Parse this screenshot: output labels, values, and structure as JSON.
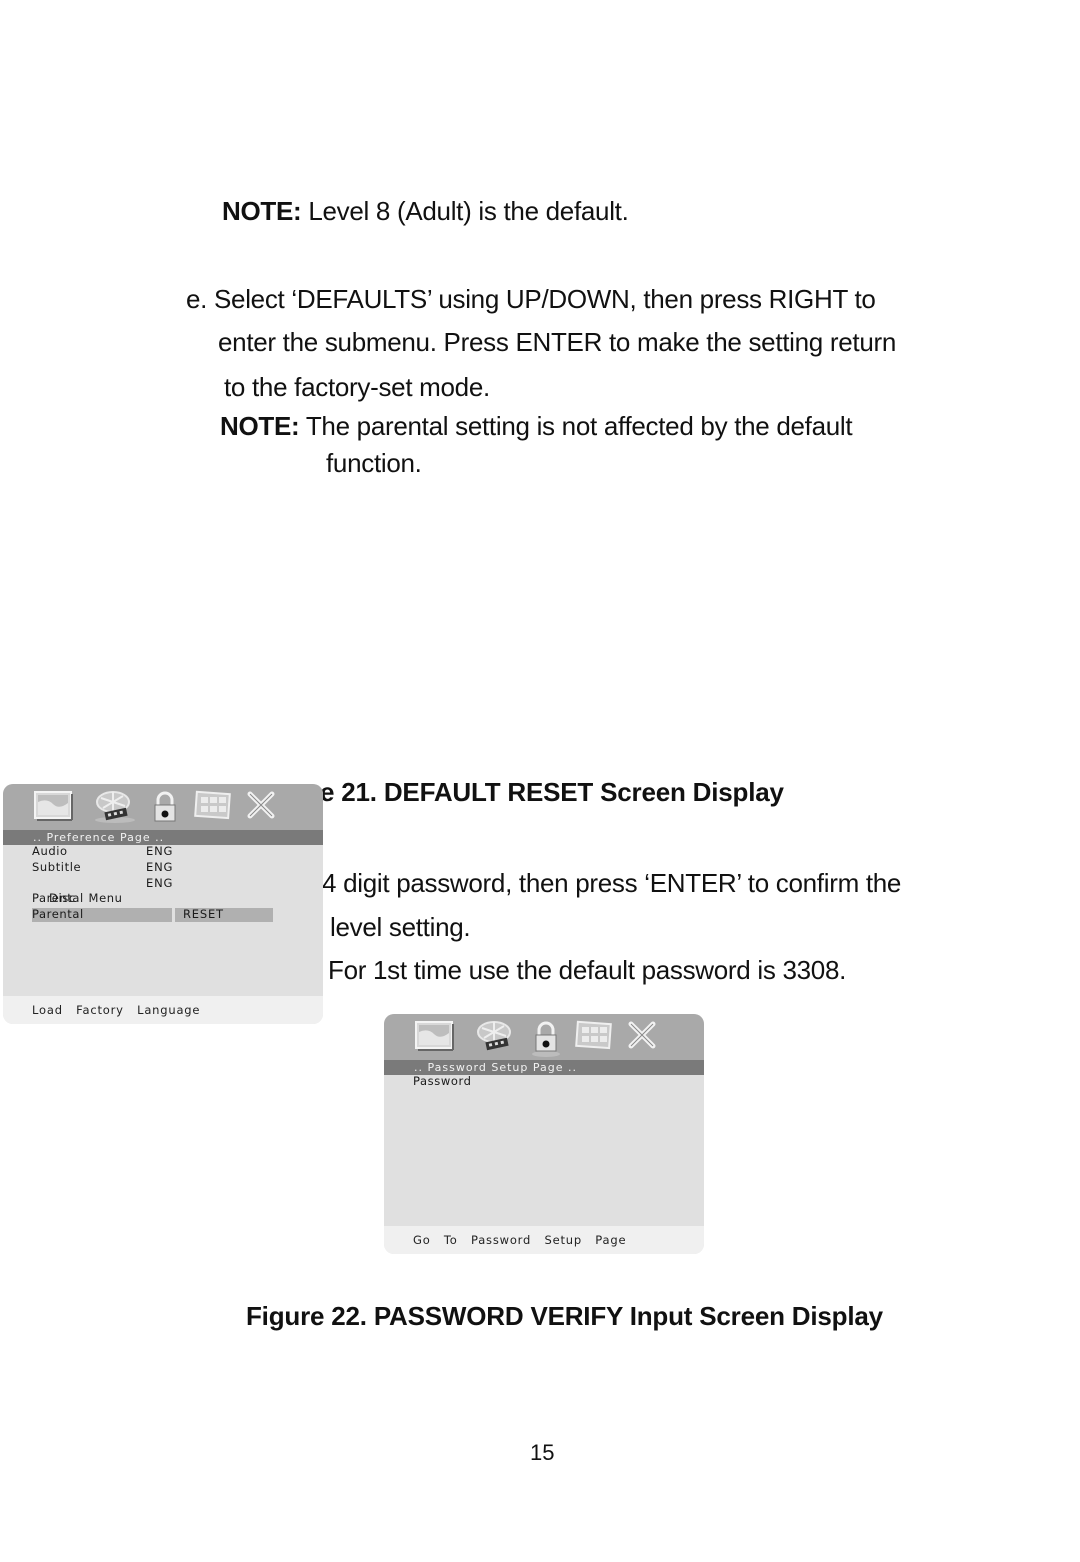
{
  "body": {
    "note1_label": "NOTE:",
    "note1_text": " Level 8 (Adult) is the default.",
    "step_e_line1": "e. Select ‘DEFAULTS’ using UP/DOWN, then press RIGHT to",
    "step_e_line2": "enter the submenu. Press ENTER to make the setting return",
    "step_e_line3": "to the factory-set mode.",
    "note2_label": "NOTE:",
    "note2_text": " The parental setting is not affected by the default",
    "note2_line2": "function.",
    "figure21_caption_visible": "e 21. DEFAULT RESET Screen Display",
    "password_line1": "4 digit password, then press ‘ENTER’ to confirm the",
    "password_line2": "level setting.",
    "password_line3": "For 1st time use the default password is 3308.",
    "figure22_caption": "Figure 22. PASSWORD VERIFY Input Screen Display",
    "page_number": "15"
  },
  "osd_preference": {
    "icons": [
      "tv-screen-icon",
      "film-reel-icon",
      "padlock-icon",
      "grid-panel-icon",
      "close-x-icon"
    ],
    "title": "..  Preference   Page  ..",
    "rows": [
      {
        "label": "Audio",
        "value": "ENG"
      },
      {
        "label": "Subtitle",
        "value": "ENG"
      },
      {
        "label": "Disc   Menu",
        "value": "ENG"
      },
      {
        "label": "Parental",
        "value": ""
      },
      {
        "label": "Parental",
        "value": "RESET",
        "highlighted": true
      }
    ],
    "footer": "Load   Factory   Language"
  },
  "osd_password": {
    "icons": [
      "tv-screen-icon",
      "film-reel-icon",
      "padlock-icon",
      "grid-panel-icon",
      "close-x-icon"
    ],
    "title": "..  Password   Setup   Page  ..",
    "rows": [
      {
        "label": "Password"
      }
    ],
    "footer": "Go   To   Password   Setup   Page"
  },
  "colors": {
    "osd_iconbar": "#a9a9a9",
    "osd_titlebar": "#7a7a7a",
    "osd_body": "#e0e0e0",
    "osd_highlight": "#b0b0b0",
    "osd_footer": "#f0f0f0"
  }
}
